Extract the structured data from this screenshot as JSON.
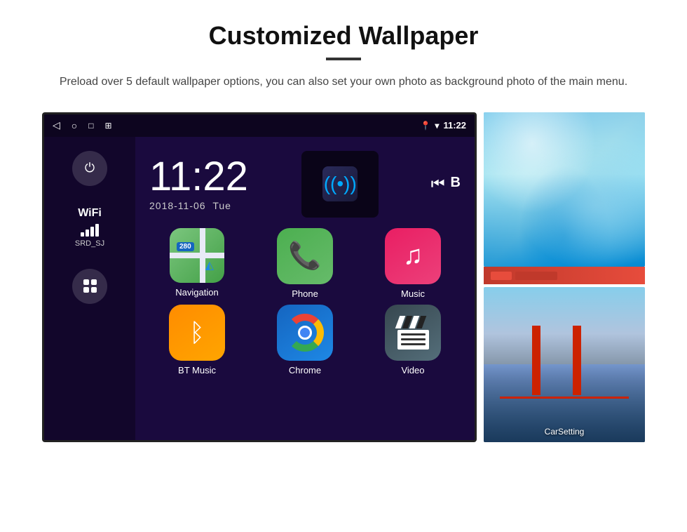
{
  "page": {
    "title": "Customized Wallpaper",
    "subtitle": "Preload over 5 default wallpaper options, you can also set your own photo as background photo of the main menu."
  },
  "android": {
    "time": "11:22",
    "date": "2018-11-06",
    "day": "Tue",
    "status_time": "11:22",
    "wifi_label": "WiFi",
    "wifi_ssid": "SRD_SJ"
  },
  "apps": [
    {
      "label": "Navigation",
      "id": "navigation"
    },
    {
      "label": "Phone",
      "id": "phone"
    },
    {
      "label": "Music",
      "id": "music"
    },
    {
      "label": "BT Music",
      "id": "bt-music"
    },
    {
      "label": "Chrome",
      "id": "chrome"
    },
    {
      "label": "Video",
      "id": "video"
    }
  ],
  "wallpapers": {
    "car_setting_label": "CarSetting",
    "top_alt": "Ice cave wallpaper",
    "bottom_alt": "Golden Gate Bridge wallpaper"
  }
}
